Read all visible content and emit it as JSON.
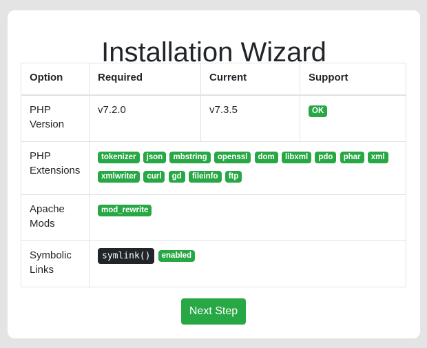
{
  "page": {
    "title": "Installation Wizard",
    "next_button": "Next Step"
  },
  "table": {
    "headers": {
      "option": "Option",
      "required": "Required",
      "current": "Current",
      "support": "Support"
    },
    "rows": {
      "php_version": {
        "option": "PHP Version",
        "required": "v7.2.0",
        "current": "v7.3.5",
        "support": "OK"
      },
      "php_extensions": {
        "option": "PHP Extensions",
        "badges": [
          "tokenizer",
          "json",
          "mbstring",
          "openssl",
          "dom",
          "libxml",
          "pdo",
          "phar",
          "xml",
          "xmlwriter",
          "curl",
          "gd",
          "fileinfo",
          "ftp"
        ]
      },
      "apache_mods": {
        "option": "Apache Mods",
        "badges": [
          "mod_rewrite"
        ]
      },
      "symbolic_links": {
        "option": "Symbolic Links",
        "code": "symlink()",
        "status": "enabled"
      }
    }
  },
  "colors": {
    "success": "#28a745",
    "dark": "#212529",
    "background": "#e4e4e4",
    "card": "#ffffff",
    "border": "#dee2e6"
  }
}
